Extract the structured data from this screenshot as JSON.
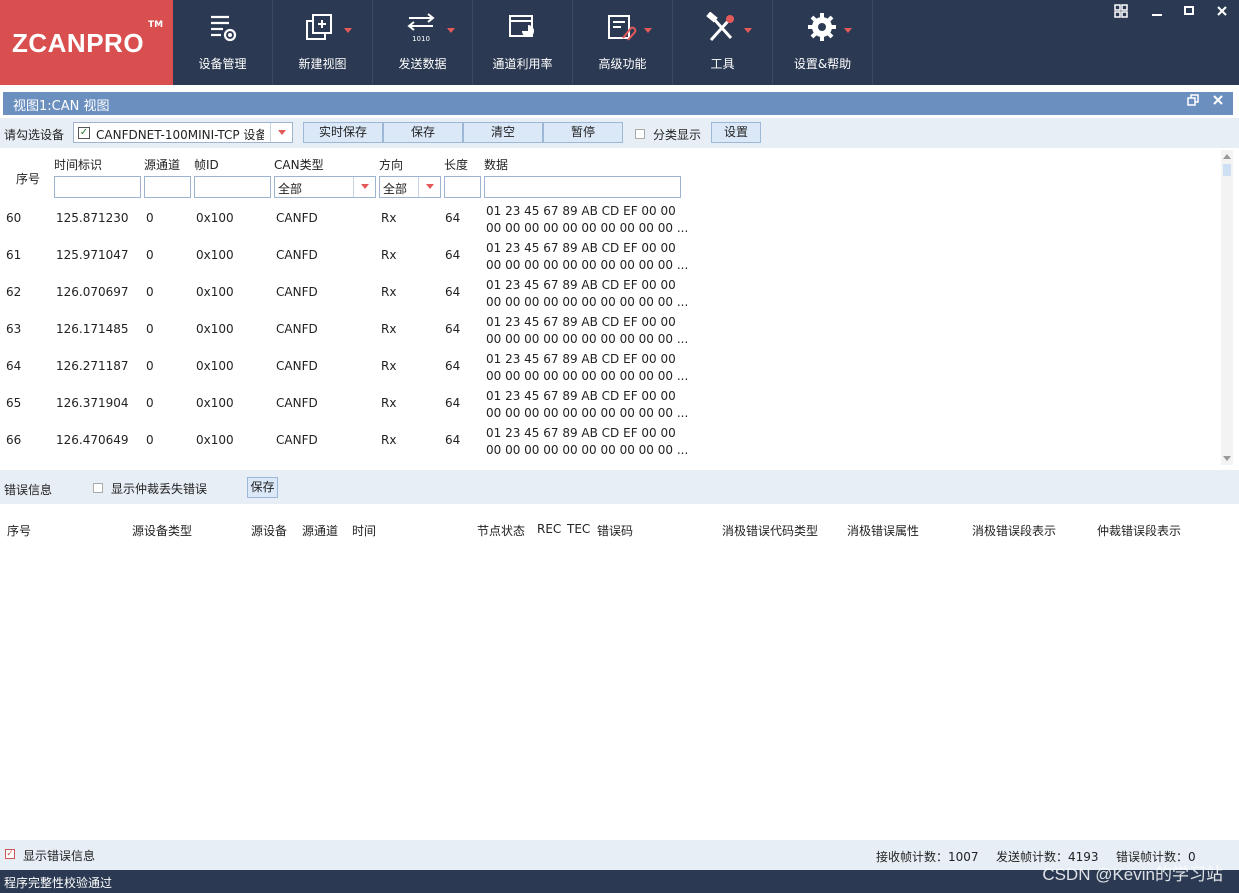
{
  "app": {
    "logo": "ZCANPRO",
    "tm": "TM"
  },
  "toolbar": [
    {
      "label": "设备管理",
      "icon": "device-manage-icon"
    },
    {
      "label": "新建视图",
      "icon": "new-view-icon"
    },
    {
      "label": "发送数据",
      "icon": "send-data-icon"
    },
    {
      "label": "通道利用率",
      "icon": "channel-usage-icon"
    },
    {
      "label": "高级功能",
      "icon": "advanced-icon"
    },
    {
      "label": "工具",
      "icon": "tools-icon"
    },
    {
      "label": "设置&帮助",
      "icon": "settings-icon"
    }
  ],
  "view": {
    "title": "视图1:CAN 视图"
  },
  "controls": {
    "select_label": "请勾选设备",
    "device_value": "CANFDNET-100MINI-TCP 设备",
    "realtime_save": "实时保存",
    "save": "保存",
    "clear": "清空",
    "pause": "暂停",
    "classify": "分类显示",
    "settings": "设置"
  },
  "table": {
    "headers": {
      "index": "序号",
      "time": "时间标识",
      "channel": "源通道",
      "id": "帧ID",
      "type": "CAN类型",
      "dir": "方向",
      "len": "长度",
      "data": "数据"
    },
    "filters": {
      "type": "全部",
      "dir": "全部"
    },
    "rows": [
      {
        "idx": "60",
        "time": "125.871230",
        "ch": "0",
        "id": "0x100",
        "type": "CANFD",
        "dir": "Rx",
        "len": "64",
        "d1": "01 23 45 67 89 AB CD EF 00 00",
        "d2": "00 00 00 00 00 00 00 00 00 00 ..."
      },
      {
        "idx": "61",
        "time": "125.971047",
        "ch": "0",
        "id": "0x100",
        "type": "CANFD",
        "dir": "Rx",
        "len": "64",
        "d1": "01 23 45 67 89 AB CD EF 00 00",
        "d2": "00 00 00 00 00 00 00 00 00 00 ..."
      },
      {
        "idx": "62",
        "time": "126.070697",
        "ch": "0",
        "id": "0x100",
        "type": "CANFD",
        "dir": "Rx",
        "len": "64",
        "d1": "01 23 45 67 89 AB CD EF 00 00",
        "d2": "00 00 00 00 00 00 00 00 00 00 ..."
      },
      {
        "idx": "63",
        "time": "126.171485",
        "ch": "0",
        "id": "0x100",
        "type": "CANFD",
        "dir": "Rx",
        "len": "64",
        "d1": "01 23 45 67 89 AB CD EF 00 00",
        "d2": "00 00 00 00 00 00 00 00 00 00 ..."
      },
      {
        "idx": "64",
        "time": "126.271187",
        "ch": "0",
        "id": "0x100",
        "type": "CANFD",
        "dir": "Rx",
        "len": "64",
        "d1": "01 23 45 67 89 AB CD EF 00 00",
        "d2": "00 00 00 00 00 00 00 00 00 00 ..."
      },
      {
        "idx": "65",
        "time": "126.371904",
        "ch": "0",
        "id": "0x100",
        "type": "CANFD",
        "dir": "Rx",
        "len": "64",
        "d1": "01 23 45 67 89 AB CD EF 00 00",
        "d2": "00 00 00 00 00 00 00 00 00 00 ..."
      },
      {
        "idx": "66",
        "time": "126.470649",
        "ch": "0",
        "id": "0x100",
        "type": "CANFD",
        "dir": "Rx",
        "len": "64",
        "d1": "01 23 45 67 89 AB CD EF 00 00",
        "d2": "00 00 00 00 00 00 00 00 00 00 ..."
      }
    ]
  },
  "errors": {
    "label": "错误信息",
    "show_arb": "显示仲裁丢失错误",
    "save": "保存",
    "headers": [
      "序号",
      "源设备类型",
      "源设备",
      "源通道",
      "时间",
      "节点状态",
      "REC",
      "TEC",
      "错误码",
      "消极错误代码类型",
      "消极错误属性",
      "消极错误段表示",
      "仲裁错误段表示"
    ]
  },
  "bottom": {
    "show_errors": "显示错误信息",
    "rx_count": "接收帧计数：1007",
    "tx_count": "发送帧计数：4193",
    "err_count": "错误帧计数：0"
  },
  "status": {
    "text": "程序完整性校验通过",
    "watermark": "CSDN @Kevin的学习站"
  }
}
